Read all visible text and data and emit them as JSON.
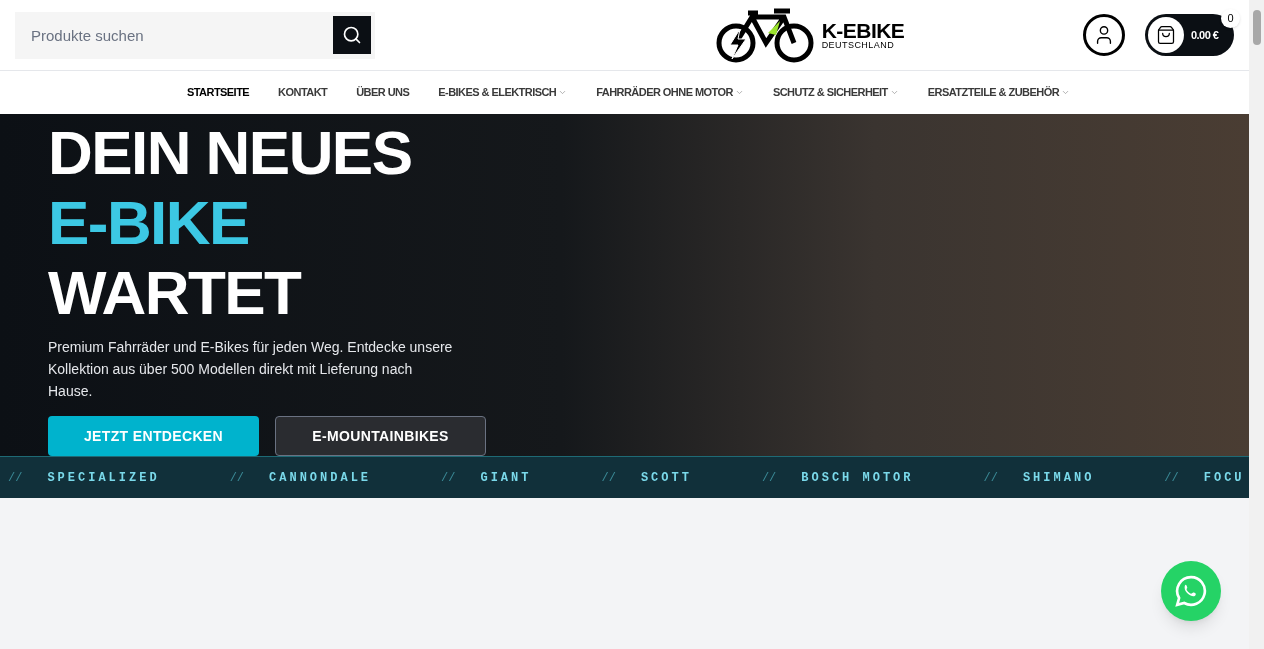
{
  "search": {
    "placeholder": "Produkte suchen"
  },
  "logo": {
    "name": "K-EBIKE",
    "subtitle": "DEUTSCHLAND"
  },
  "cart": {
    "total": "0.00 €",
    "count": "0"
  },
  "nav": [
    {
      "label": "STARTSEITE",
      "selected": true,
      "has_menu": false
    },
    {
      "label": "KONTAKT",
      "selected": false,
      "has_menu": false
    },
    {
      "label": "ÜBER UNS",
      "selected": false,
      "has_menu": false
    },
    {
      "label": "E-BIKES & ELEKTRISCH",
      "selected": false,
      "has_menu": true
    },
    {
      "label": "FAHRRÄDER OHNE MOTOR",
      "selected": false,
      "has_menu": true
    },
    {
      "label": "SCHUTZ & SICHERHEIT",
      "selected": false,
      "has_menu": true
    },
    {
      "label": "ERSATZTEILE & ZUBEHÖR",
      "selected": false,
      "has_menu": true
    }
  ],
  "hero": {
    "headline": [
      {
        "text": "DEIN NEUES",
        "highlight": false
      },
      {
        "text": "E-BIKE",
        "highlight": true
      },
      {
        "text": "WARTET",
        "highlight": false
      }
    ],
    "description": "Premium Fahrräder und E-Bikes für jeden Weg. Entdecke unsere Kollektion aus über 500 Modellen direkt mit Lieferung nach Hause.",
    "buttons": [
      {
        "label": "JETZT ENTDECKEN",
        "kind": "primary"
      },
      {
        "label": "E-MOUNTAINBIKES",
        "kind": "outline"
      }
    ]
  },
  "ticker": [
    {
      "separator": "//",
      "brand": "SPECIALIZED"
    },
    {
      "separator": "//",
      "brand": "CANNONDALE"
    },
    {
      "separator": "//",
      "brand": "GIANT"
    },
    {
      "separator": "//",
      "brand": "SCOTT"
    },
    {
      "separator": "//",
      "brand": "BOSCH MOTOR"
    },
    {
      "separator": "//",
      "brand": "SHIMANO"
    },
    {
      "separator": "//",
      "brand": "FOCU"
    }
  ]
}
